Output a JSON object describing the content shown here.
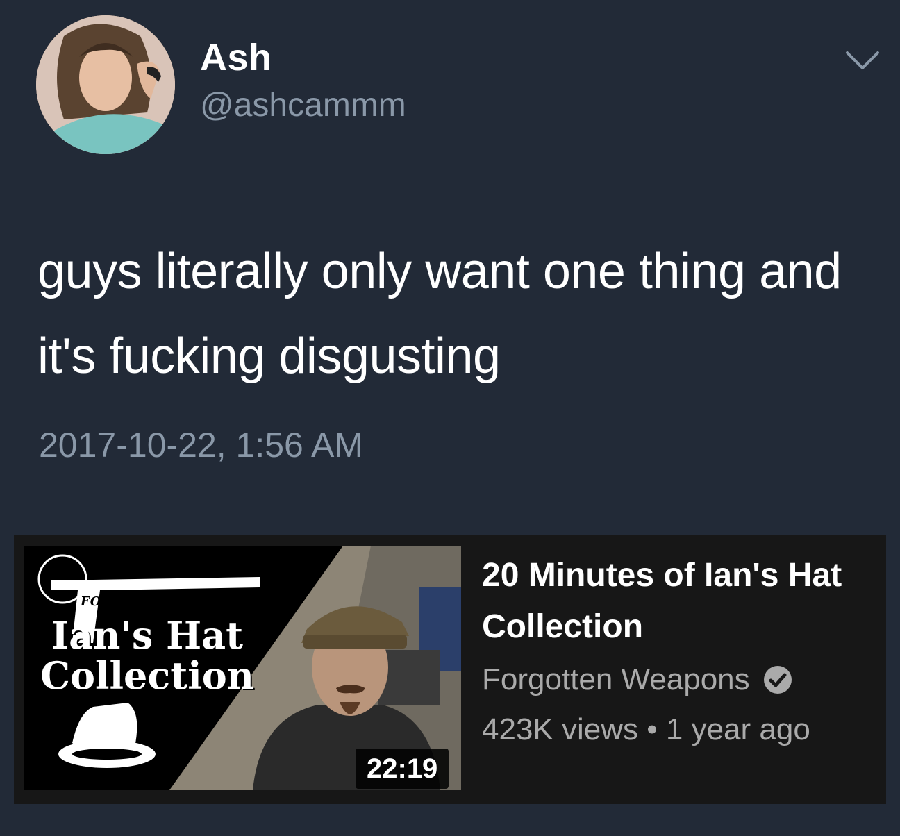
{
  "tweet": {
    "display_name": "Ash",
    "handle": "@ashcammm",
    "text": "guys literally only want one thing and it's fucking disgusting",
    "timestamp": "2017-10-22, 1:56 AM",
    "menu_icon": "chevron-down-icon"
  },
  "youtube_card": {
    "thumbnail": {
      "overlay_title": "Ian's Hat Collection",
      "brand": "FORGOTTEN WEAPONS.com",
      "duration": "22:19"
    },
    "title": "20 Minutes of Ian's Hat Collection",
    "channel": "Forgotten Weapons",
    "verified_icon": "verified-check-icon",
    "views": "423K views",
    "separator": "•",
    "age": "1 year ago"
  },
  "colors": {
    "tweet_bg": "#222a37",
    "card_bg": "#171717",
    "secondary_text": "#8a98a8"
  }
}
